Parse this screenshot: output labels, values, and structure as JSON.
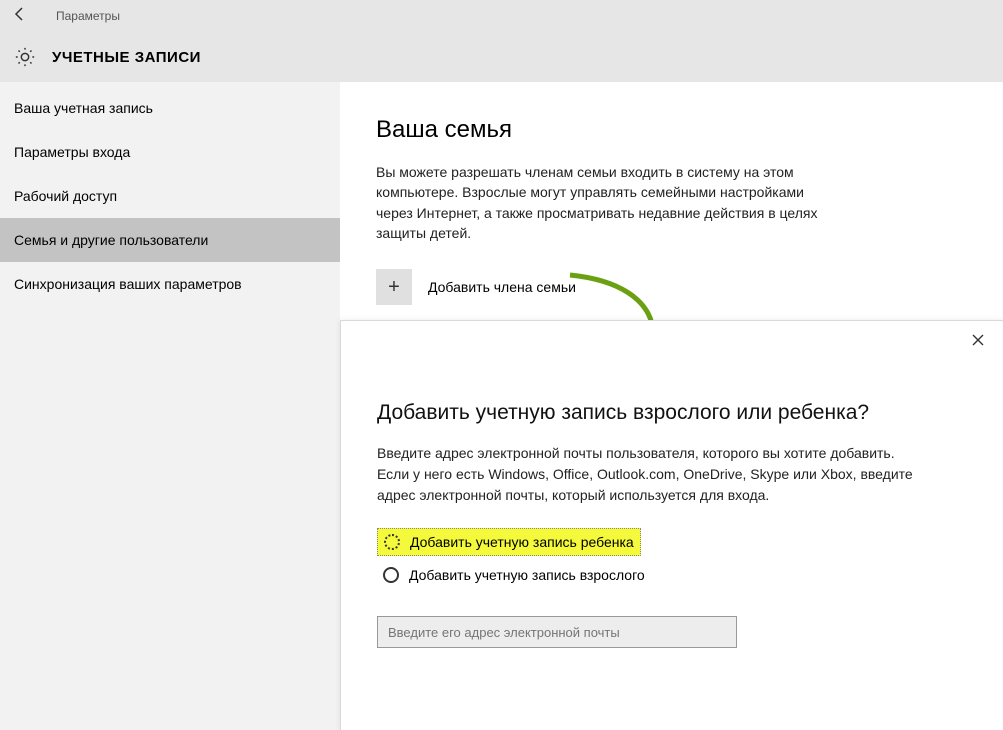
{
  "titlebar": {
    "title": "Параметры"
  },
  "header": {
    "title": "УЧЕТНЫЕ ЗАПИСИ"
  },
  "sidebar": {
    "items": [
      {
        "label": "Ваша учетная запись"
      },
      {
        "label": "Параметры входа"
      },
      {
        "label": "Рабочий доступ"
      },
      {
        "label": "Семья и другие пользователи"
      },
      {
        "label": "Синхронизация ваших параметров"
      }
    ]
  },
  "main": {
    "heading": "Ваша семья",
    "description": "Вы можете разрешать членам семьи входить в систему на этом компьютере. Взрослые могут управлять семейными настройками через Интернет, а также просматривать недавние действия в целях защиты детей.",
    "add_label": "Добавить члена семьи"
  },
  "dialog": {
    "title": "Добавить учетную запись взрослого или ребенка?",
    "description": "Введите адрес электронной почты пользователя, которого вы хотите добавить. Если у него есть Windows, Office, Outlook.com, OneDrive, Skype или Xbox, введите адрес электронной почты, который используется для входа.",
    "option_child": "Добавить учетную запись ребенка",
    "option_adult": "Добавить учетную запись взрослого",
    "email_placeholder": "Введите его адрес электронной почты"
  }
}
